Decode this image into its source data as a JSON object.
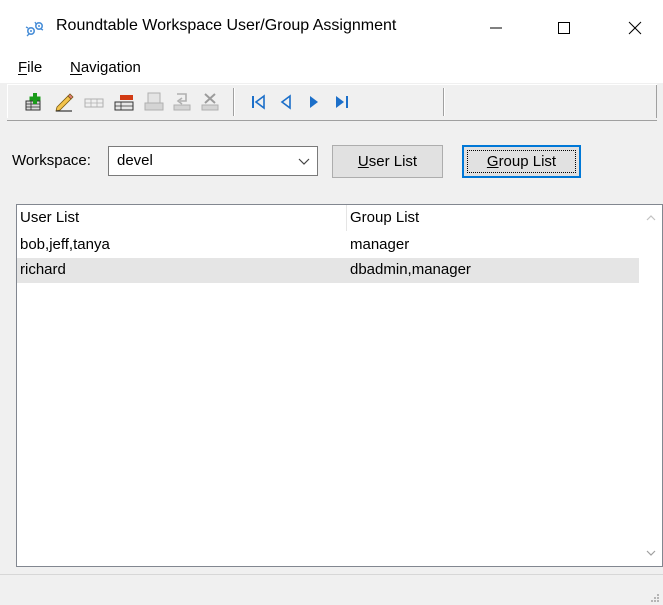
{
  "window": {
    "title": "Roundtable Workspace User/Group Assignment"
  },
  "menu": {
    "items": [
      {
        "label": "File",
        "mnemonic_width": 9
      },
      {
        "label": "Navigation",
        "mnemonic_width": 12
      }
    ]
  },
  "toolbar": {
    "buttons": [
      {
        "icon": "add-record-icon",
        "enabled": true
      },
      {
        "icon": "edit-record-icon",
        "enabled": true
      },
      {
        "icon": "copy-record-icon",
        "enabled": false
      },
      {
        "icon": "delete-record-icon",
        "enabled": true
      },
      {
        "icon": "save-record-icon",
        "enabled": false
      },
      {
        "icon": "undo-record-icon",
        "enabled": false
      },
      {
        "icon": "cancel-record-icon",
        "enabled": false
      },
      {
        "icon": "first-record-icon",
        "enabled": true
      },
      {
        "icon": "previous-record-icon",
        "enabled": true
      },
      {
        "icon": "next-record-icon",
        "enabled": true
      },
      {
        "icon": "last-record-icon",
        "enabled": true
      }
    ]
  },
  "workspace": {
    "label": "Workspace:",
    "value": "devel"
  },
  "buttons": {
    "user_list": "User List",
    "group_list": "Group List"
  },
  "list": {
    "columns": [
      "User List",
      "Group List"
    ],
    "rows": [
      {
        "user_list": "bob,jeff,tanya",
        "group_list": "manager",
        "selected": false
      },
      {
        "user_list": "richard",
        "group_list": "dbadmin,manager",
        "selected": true
      }
    ]
  },
  "colors": {
    "focus_border": "#0078d7",
    "selection": "#e5e5e5",
    "add_icon": "#1a9b1a",
    "delete_icon": "#d23b14",
    "nav_icon": "#1c6fc9"
  }
}
